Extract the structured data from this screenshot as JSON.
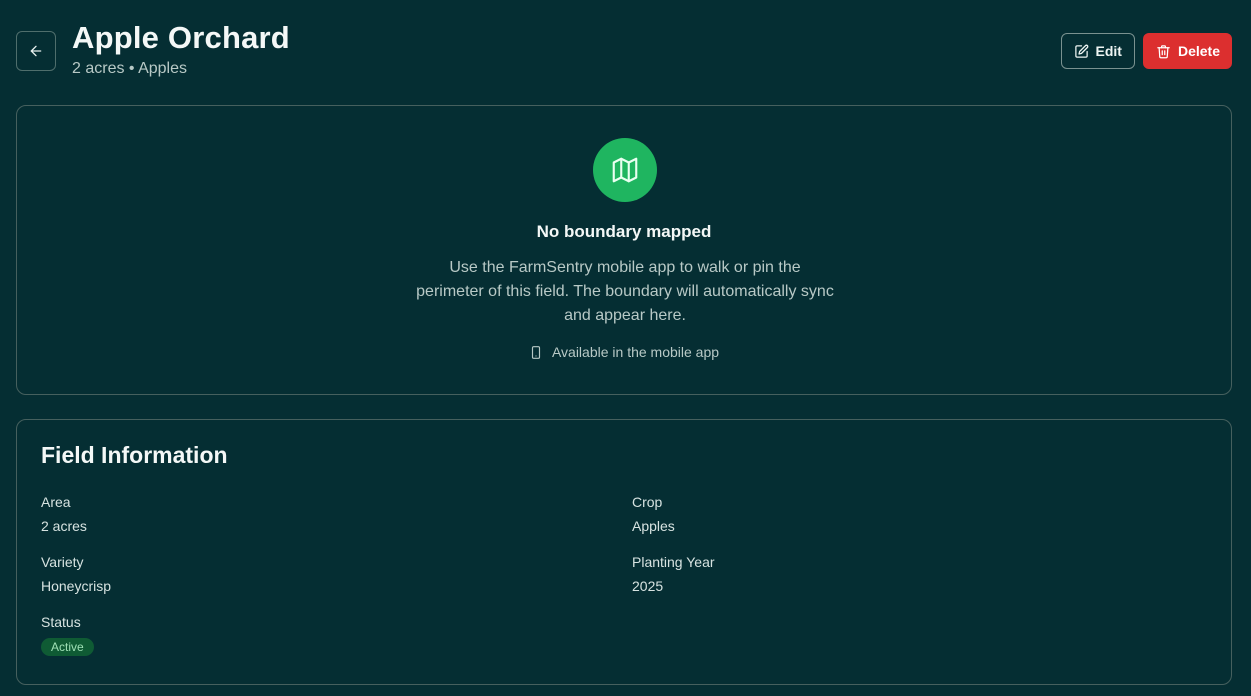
{
  "header": {
    "title": "Apple Orchard",
    "subtitle": "2 acres • Apples",
    "edit_label": "Edit",
    "delete_label": "Delete"
  },
  "boundary": {
    "title": "No boundary mapped",
    "description": "Use the FarmSentry mobile app to walk or pin the perimeter of this field. The boundary will automatically sync and appear here.",
    "mobile_note": "Available in the mobile app"
  },
  "field_info": {
    "title": "Field Information",
    "area_label": "Area",
    "area_value": "2 acres",
    "crop_label": "Crop",
    "crop_value": "Apples",
    "variety_label": "Variety",
    "variety_value": "Honeycrisp",
    "planting_year_label": "Planting Year",
    "planting_year_value": "2025",
    "status_label": "Status",
    "status_value": "Active"
  },
  "icons": {
    "back": "arrow-left-icon",
    "edit": "pencil-square-icon",
    "delete": "trash-icon",
    "map": "map-icon",
    "mobile": "smartphone-icon"
  },
  "colors": {
    "background": "#052e33",
    "accent_green": "#1fb560",
    "danger": "#dc2f2f",
    "badge_bg": "#0f5b34",
    "badge_text": "#9fe0b5"
  }
}
